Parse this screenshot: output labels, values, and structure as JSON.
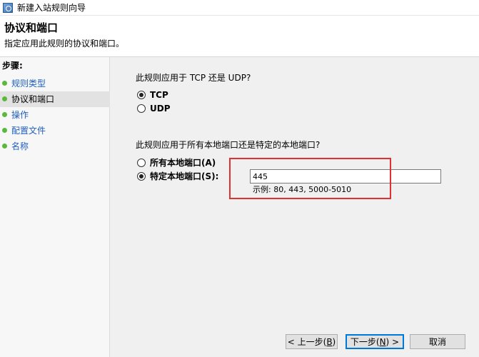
{
  "window": {
    "title": "新建入站规则向导"
  },
  "header": {
    "title": "协议和端口",
    "description": "指定应用此规则的协议和端口。"
  },
  "sidebar": {
    "steps_label": "步骤:",
    "items": [
      {
        "label": "规则类型"
      },
      {
        "label": "协议和端口"
      },
      {
        "label": "操作"
      },
      {
        "label": "配置文件"
      },
      {
        "label": "名称"
      }
    ]
  },
  "protocol": {
    "question": "此规则应用于 TCP 还是 UDP?",
    "options": [
      {
        "label": "TCP",
        "checked": true
      },
      {
        "label": "UDP",
        "checked": false
      }
    ]
  },
  "ports": {
    "question": "此规则应用于所有本地端口还是特定的本地端口?",
    "options": [
      {
        "label": "所有本地端口(A)",
        "checked": false
      },
      {
        "label": "特定本地端口(S):",
        "checked": true
      }
    ],
    "value": "445",
    "example": "示例: 80, 443, 5000-5010"
  },
  "buttons": {
    "back": {
      "prefix": "< 上一步(",
      "key": "B",
      "suffix": ")"
    },
    "next": {
      "prefix": "下一步(",
      "key": "N",
      "suffix": ") >"
    },
    "cancel": "取消"
  },
  "colors": {
    "highlight_border": "#e03030",
    "step_dot": "#5cb83c",
    "link": "#1f5fbf",
    "primary_button_border": "#0078d7"
  }
}
